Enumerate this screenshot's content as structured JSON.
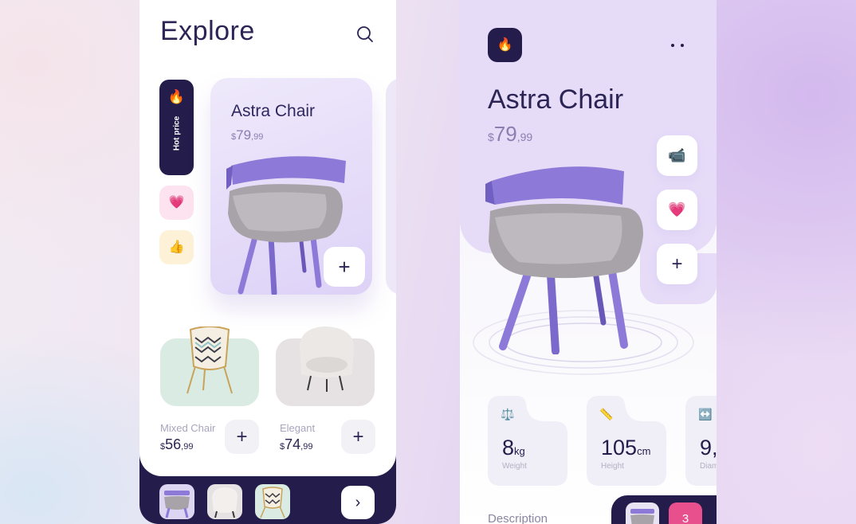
{
  "explore": {
    "title": "Explore",
    "search_icon": "search-icon",
    "hot": {
      "icon": "fire-icon",
      "label": "Hot price"
    },
    "favorite_icon": "heart-icon",
    "like_icon": "thumbs-up-icon",
    "featured": {
      "name": "Astra Chair",
      "currency": "$",
      "price_main": "79",
      "price_cents": ",99",
      "add_label": "+"
    },
    "products": [
      {
        "name": "Mixed Chair",
        "currency": "$",
        "price_main": "56",
        "price_cents": ",99",
        "add_label": "+"
      },
      {
        "name": "Elegant",
        "currency": "$",
        "price_main": "74",
        "price_cents": ",99",
        "add_label": "+"
      }
    ],
    "bottom_nav": {
      "next_label": "›"
    }
  },
  "detail": {
    "fire_icon": "fire-icon",
    "more_icon": "more-dots-icon",
    "title": "Astra Chair",
    "currency": "$",
    "price_main": "79",
    "price_cents": ",99",
    "actions": {
      "camera_icon": "video-camera-icon",
      "favorite_icon": "heart-icon",
      "add_label": "+"
    },
    "specs": [
      {
        "icon": "scale-icon",
        "value": "8",
        "unit": "kg",
        "label": "Weight"
      },
      {
        "icon": "ruler-icon",
        "value": "105",
        "unit": "cm",
        "label": "Height"
      },
      {
        "icon": "width-arrows-icon",
        "value": "9,",
        "unit": "",
        "label": "Diam"
      }
    ],
    "description_label": "Description",
    "cart_count": "3"
  },
  "colors": {
    "navy": "#241c4b",
    "lavender": "#e6dcf8",
    "chair_purple": "#8b79d6",
    "fabric_gray": "#a9a6ac",
    "pink_badge": "#e7508c"
  }
}
